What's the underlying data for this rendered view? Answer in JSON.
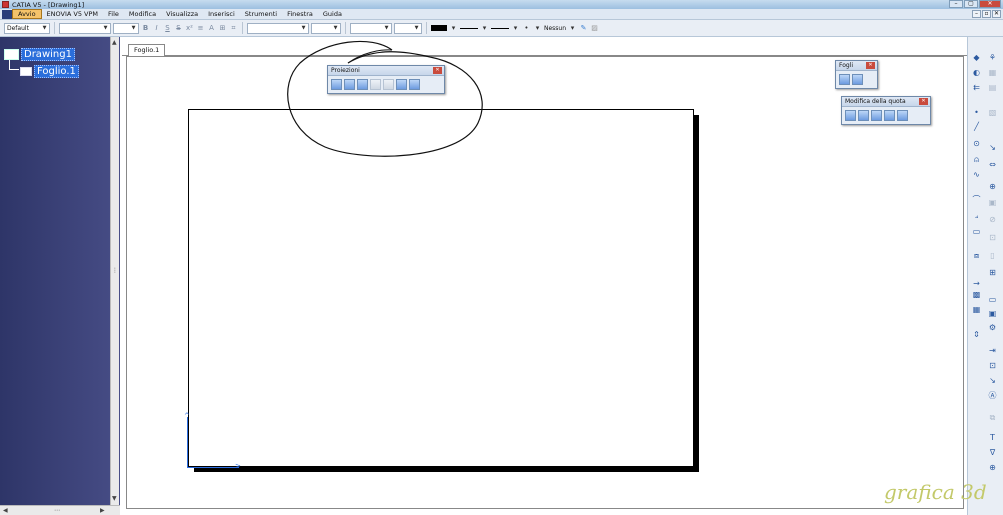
{
  "window": {
    "title": "CATIA V5 - [Drawing1]",
    "controls": [
      "–",
      "▢",
      "✕"
    ]
  },
  "menubar": {
    "items": [
      "Avvio",
      "ENOVIA V5 VPM",
      "File",
      "Modifica",
      "Visualizza",
      "Inserisci",
      "Strumenti",
      "Finestra",
      "Guida"
    ],
    "mdi_controls": [
      "–",
      "▫",
      "✕"
    ]
  },
  "format_toolbar": {
    "style_combo": "Default",
    "font_combo": "",
    "size_combo": "",
    "bold": "B",
    "italic": "I",
    "underline": "S",
    "strike": "S",
    "superscript": "x²",
    "linetype_label": "Nessun"
  },
  "tree": {
    "root_label": "Drawing1",
    "child_label": "Foglio.1"
  },
  "sheet_tab": {
    "label": "Foglio.1"
  },
  "floating_toolbars": {
    "proiezioni": {
      "title": "Proiezioni",
      "icon_count": 7
    },
    "fogli": {
      "title": "Fogli",
      "icon_count": 2
    },
    "modifica_quota": {
      "title": "Modifica della quota",
      "icon_count": 5
    }
  },
  "colors": {
    "tree_bg": "#2e3568",
    "tree_selection": "#2b6edb",
    "axis": "#2d6ee0",
    "close_button": "#c94b3d"
  },
  "right_toolbar_icons": [
    "view-icon",
    "projection-icon",
    "section-icon",
    "point-icon",
    "line-icon",
    "circle-icon",
    "spline-icon",
    "arc-icon",
    "corner-icon",
    "rectangle-icon",
    "dimension-icon",
    "table-icon",
    "balloon-icon",
    "text-icon",
    "symbol-icon"
  ],
  "watermark": {
    "text": "grafica 3d"
  }
}
